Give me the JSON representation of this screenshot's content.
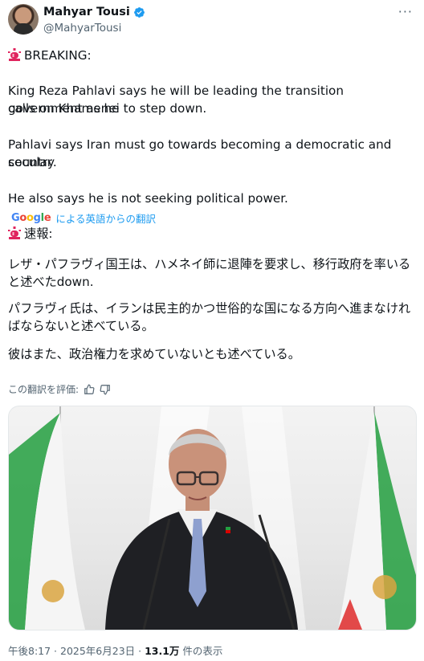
{
  "author": {
    "display_name": "Mahyar Tousi",
    "handle": "@MahyarTousi",
    "more_label": "···"
  },
  "tweet": {
    "breaking": "BREAKING:",
    "para1": [
      "King Reza Pahlavi says he will be leading the transition government as he",
      "calls on Khamenei to step down."
    ],
    "para2": [
      "Pahlavi says Iran must go towards becoming a democratic and secular",
      "country."
    ],
    "para3": "He also says he is not seeking political power."
  },
  "translation": {
    "provider_logo": "Google",
    "label": "による英語からの翻訳",
    "breaking": "速報:",
    "para1": [
      "レザ・パフラヴィ国王は、ハメネイ師に退陣を要求し、移行政府を率いる",
      "と述べたdown."
    ],
    "para2": [
      "パフラヴィ氏は、イランは民主的かつ世俗的な国になる方向へ進まなけれ",
      "ばならないと述べている。"
    ],
    "para3": "彼はまた、政治権力を求めていないとも述べている。",
    "rate_label": "この翻訳を評価:"
  },
  "footer": {
    "time_date": "午後8:17 · 2025年6月23日 · ",
    "views_count": "13.1万",
    "views_label": " 件の表示"
  },
  "colors": {
    "link": "#1d9bf0",
    "muted": "#536471",
    "siren": "#e0245e",
    "flag_green": "#239f40",
    "flag_red": "#da0000"
  },
  "icons": {
    "verified": "verified-badge-icon",
    "siren": "police-light-icon",
    "thumb_up": "thumbs-up-icon",
    "thumb_down": "thumbs-down-icon",
    "more": "more-options-icon"
  }
}
